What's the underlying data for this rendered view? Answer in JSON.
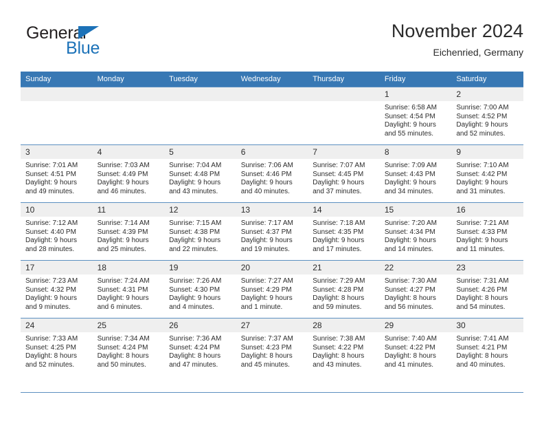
{
  "brand": {
    "name_top": "General",
    "name_bottom": "Blue",
    "accent_color": "#1c72b8",
    "triangle_icon": "brand-triangle-icon"
  },
  "header": {
    "title": "November 2024",
    "subtitle": "Eichenried, Germany"
  },
  "theme": {
    "header_bg": "#3878b4",
    "daynum_bg": "#efefef",
    "rule_color": "#5b8fc0",
    "text_color": "#2b2b2b"
  },
  "weekday_headers": [
    "Sunday",
    "Monday",
    "Tuesday",
    "Wednesday",
    "Thursday",
    "Friday",
    "Saturday"
  ],
  "weeks": [
    [
      {
        "day": "",
        "sunrise": "",
        "sunset": "",
        "daylight1": "",
        "daylight2": ""
      },
      {
        "day": "",
        "sunrise": "",
        "sunset": "",
        "daylight1": "",
        "daylight2": ""
      },
      {
        "day": "",
        "sunrise": "",
        "sunset": "",
        "daylight1": "",
        "daylight2": ""
      },
      {
        "day": "",
        "sunrise": "",
        "sunset": "",
        "daylight1": "",
        "daylight2": ""
      },
      {
        "day": "",
        "sunrise": "",
        "sunset": "",
        "daylight1": "",
        "daylight2": ""
      },
      {
        "day": "1",
        "sunrise": "Sunrise: 6:58 AM",
        "sunset": "Sunset: 4:54 PM",
        "daylight1": "Daylight: 9 hours",
        "daylight2": "and 55 minutes."
      },
      {
        "day": "2",
        "sunrise": "Sunrise: 7:00 AM",
        "sunset": "Sunset: 4:52 PM",
        "daylight1": "Daylight: 9 hours",
        "daylight2": "and 52 minutes."
      }
    ],
    [
      {
        "day": "3",
        "sunrise": "Sunrise: 7:01 AM",
        "sunset": "Sunset: 4:51 PM",
        "daylight1": "Daylight: 9 hours",
        "daylight2": "and 49 minutes."
      },
      {
        "day": "4",
        "sunrise": "Sunrise: 7:03 AM",
        "sunset": "Sunset: 4:49 PM",
        "daylight1": "Daylight: 9 hours",
        "daylight2": "and 46 minutes."
      },
      {
        "day": "5",
        "sunrise": "Sunrise: 7:04 AM",
        "sunset": "Sunset: 4:48 PM",
        "daylight1": "Daylight: 9 hours",
        "daylight2": "and 43 minutes."
      },
      {
        "day": "6",
        "sunrise": "Sunrise: 7:06 AM",
        "sunset": "Sunset: 4:46 PM",
        "daylight1": "Daylight: 9 hours",
        "daylight2": "and 40 minutes."
      },
      {
        "day": "7",
        "sunrise": "Sunrise: 7:07 AM",
        "sunset": "Sunset: 4:45 PM",
        "daylight1": "Daylight: 9 hours",
        "daylight2": "and 37 minutes."
      },
      {
        "day": "8",
        "sunrise": "Sunrise: 7:09 AM",
        "sunset": "Sunset: 4:43 PM",
        "daylight1": "Daylight: 9 hours",
        "daylight2": "and 34 minutes."
      },
      {
        "day": "9",
        "sunrise": "Sunrise: 7:10 AM",
        "sunset": "Sunset: 4:42 PM",
        "daylight1": "Daylight: 9 hours",
        "daylight2": "and 31 minutes."
      }
    ],
    [
      {
        "day": "10",
        "sunrise": "Sunrise: 7:12 AM",
        "sunset": "Sunset: 4:40 PM",
        "daylight1": "Daylight: 9 hours",
        "daylight2": "and 28 minutes."
      },
      {
        "day": "11",
        "sunrise": "Sunrise: 7:14 AM",
        "sunset": "Sunset: 4:39 PM",
        "daylight1": "Daylight: 9 hours",
        "daylight2": "and 25 minutes."
      },
      {
        "day": "12",
        "sunrise": "Sunrise: 7:15 AM",
        "sunset": "Sunset: 4:38 PM",
        "daylight1": "Daylight: 9 hours",
        "daylight2": "and 22 minutes."
      },
      {
        "day": "13",
        "sunrise": "Sunrise: 7:17 AM",
        "sunset": "Sunset: 4:37 PM",
        "daylight1": "Daylight: 9 hours",
        "daylight2": "and 19 minutes."
      },
      {
        "day": "14",
        "sunrise": "Sunrise: 7:18 AM",
        "sunset": "Sunset: 4:35 PM",
        "daylight1": "Daylight: 9 hours",
        "daylight2": "and 17 minutes."
      },
      {
        "day": "15",
        "sunrise": "Sunrise: 7:20 AM",
        "sunset": "Sunset: 4:34 PM",
        "daylight1": "Daylight: 9 hours",
        "daylight2": "and 14 minutes."
      },
      {
        "day": "16",
        "sunrise": "Sunrise: 7:21 AM",
        "sunset": "Sunset: 4:33 PM",
        "daylight1": "Daylight: 9 hours",
        "daylight2": "and 11 minutes."
      }
    ],
    [
      {
        "day": "17",
        "sunrise": "Sunrise: 7:23 AM",
        "sunset": "Sunset: 4:32 PM",
        "daylight1": "Daylight: 9 hours",
        "daylight2": "and 9 minutes."
      },
      {
        "day": "18",
        "sunrise": "Sunrise: 7:24 AM",
        "sunset": "Sunset: 4:31 PM",
        "daylight1": "Daylight: 9 hours",
        "daylight2": "and 6 minutes."
      },
      {
        "day": "19",
        "sunrise": "Sunrise: 7:26 AM",
        "sunset": "Sunset: 4:30 PM",
        "daylight1": "Daylight: 9 hours",
        "daylight2": "and 4 minutes."
      },
      {
        "day": "20",
        "sunrise": "Sunrise: 7:27 AM",
        "sunset": "Sunset: 4:29 PM",
        "daylight1": "Daylight: 9 hours",
        "daylight2": "and 1 minute."
      },
      {
        "day": "21",
        "sunrise": "Sunrise: 7:29 AM",
        "sunset": "Sunset: 4:28 PM",
        "daylight1": "Daylight: 8 hours",
        "daylight2": "and 59 minutes."
      },
      {
        "day": "22",
        "sunrise": "Sunrise: 7:30 AM",
        "sunset": "Sunset: 4:27 PM",
        "daylight1": "Daylight: 8 hours",
        "daylight2": "and 56 minutes."
      },
      {
        "day": "23",
        "sunrise": "Sunrise: 7:31 AM",
        "sunset": "Sunset: 4:26 PM",
        "daylight1": "Daylight: 8 hours",
        "daylight2": "and 54 minutes."
      }
    ],
    [
      {
        "day": "24",
        "sunrise": "Sunrise: 7:33 AM",
        "sunset": "Sunset: 4:25 PM",
        "daylight1": "Daylight: 8 hours",
        "daylight2": "and 52 minutes."
      },
      {
        "day": "25",
        "sunrise": "Sunrise: 7:34 AM",
        "sunset": "Sunset: 4:24 PM",
        "daylight1": "Daylight: 8 hours",
        "daylight2": "and 50 minutes."
      },
      {
        "day": "26",
        "sunrise": "Sunrise: 7:36 AM",
        "sunset": "Sunset: 4:24 PM",
        "daylight1": "Daylight: 8 hours",
        "daylight2": "and 47 minutes."
      },
      {
        "day": "27",
        "sunrise": "Sunrise: 7:37 AM",
        "sunset": "Sunset: 4:23 PM",
        "daylight1": "Daylight: 8 hours",
        "daylight2": "and 45 minutes."
      },
      {
        "day": "28",
        "sunrise": "Sunrise: 7:38 AM",
        "sunset": "Sunset: 4:22 PM",
        "daylight1": "Daylight: 8 hours",
        "daylight2": "and 43 minutes."
      },
      {
        "day": "29",
        "sunrise": "Sunrise: 7:40 AM",
        "sunset": "Sunset: 4:22 PM",
        "daylight1": "Daylight: 8 hours",
        "daylight2": "and 41 minutes."
      },
      {
        "day": "30",
        "sunrise": "Sunrise: 7:41 AM",
        "sunset": "Sunset: 4:21 PM",
        "daylight1": "Daylight: 8 hours",
        "daylight2": "and 40 minutes."
      }
    ]
  ]
}
